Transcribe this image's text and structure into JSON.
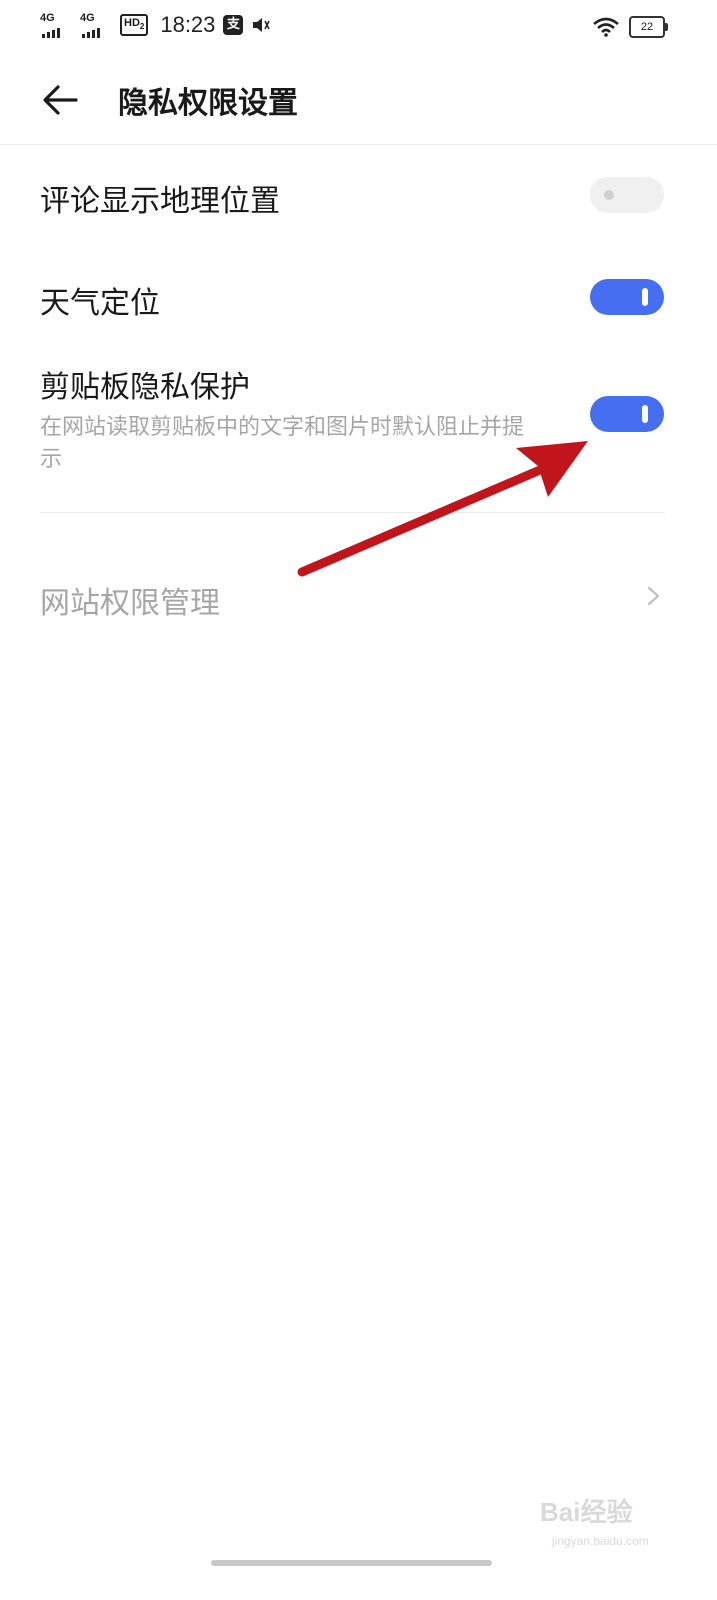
{
  "status_bar": {
    "network1": "4G",
    "network2": "4G",
    "hd_badge": "HD",
    "hd_sub": "2",
    "time": "18:23",
    "alipay_icon_text": "支",
    "battery_level": "22"
  },
  "header": {
    "title": "隐私权限设置"
  },
  "settings": {
    "comment_location": {
      "label": "评论显示地理位置",
      "enabled": false
    },
    "weather_location": {
      "label": "天气定位",
      "enabled": true
    },
    "clipboard_protect": {
      "label": "剪贴板隐私保护",
      "description": "在网站读取剪贴板中的文字和图片时默认阻止并提示",
      "enabled": true
    },
    "site_permission": {
      "label": "网站权限管理"
    }
  },
  "watermark": {
    "brand": "Bai经验",
    "url": "jingyan.baidu.com"
  },
  "colors": {
    "toggle_on": "#456ff0",
    "toggle_off": "#f0f0f0",
    "annotation_arrow": "#c0161b",
    "disabled_text": "#a6a6a6"
  }
}
